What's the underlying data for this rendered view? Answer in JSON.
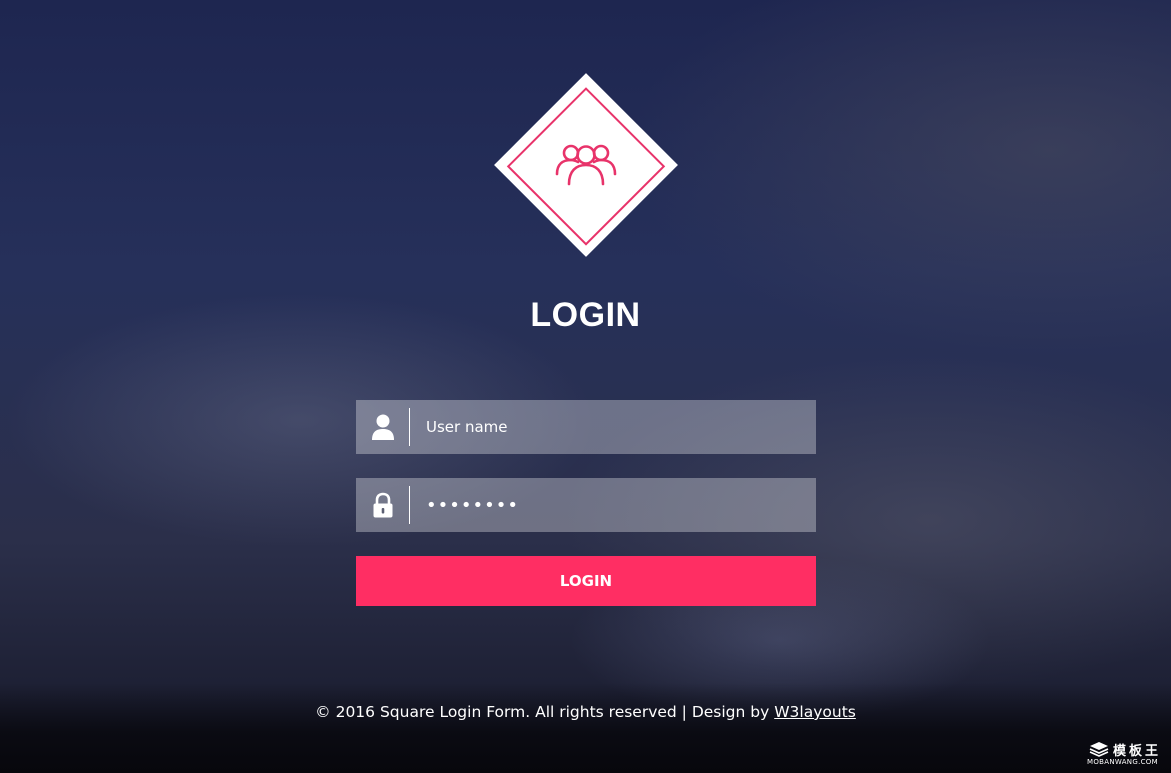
{
  "header": {
    "title": "LOGIN",
    "logo_icon": "users-group-icon"
  },
  "form": {
    "username": {
      "placeholder": "User name",
      "value": "",
      "icon": "user-icon"
    },
    "password": {
      "value": "password",
      "icon": "lock-icon"
    },
    "submit_label": "LOGIN"
  },
  "footer": {
    "text": "© 2016 Square Login Form. All rights reserved | Design by ",
    "link_label": "W3layouts"
  },
  "watermark": {
    "name": "模板王",
    "url": "MOBANWANG.COM"
  },
  "colors": {
    "accent": "#ff2e63",
    "icon_pink": "#e8336a",
    "field_bg": "rgba(255,255,255,0.32)",
    "text": "#ffffff"
  }
}
